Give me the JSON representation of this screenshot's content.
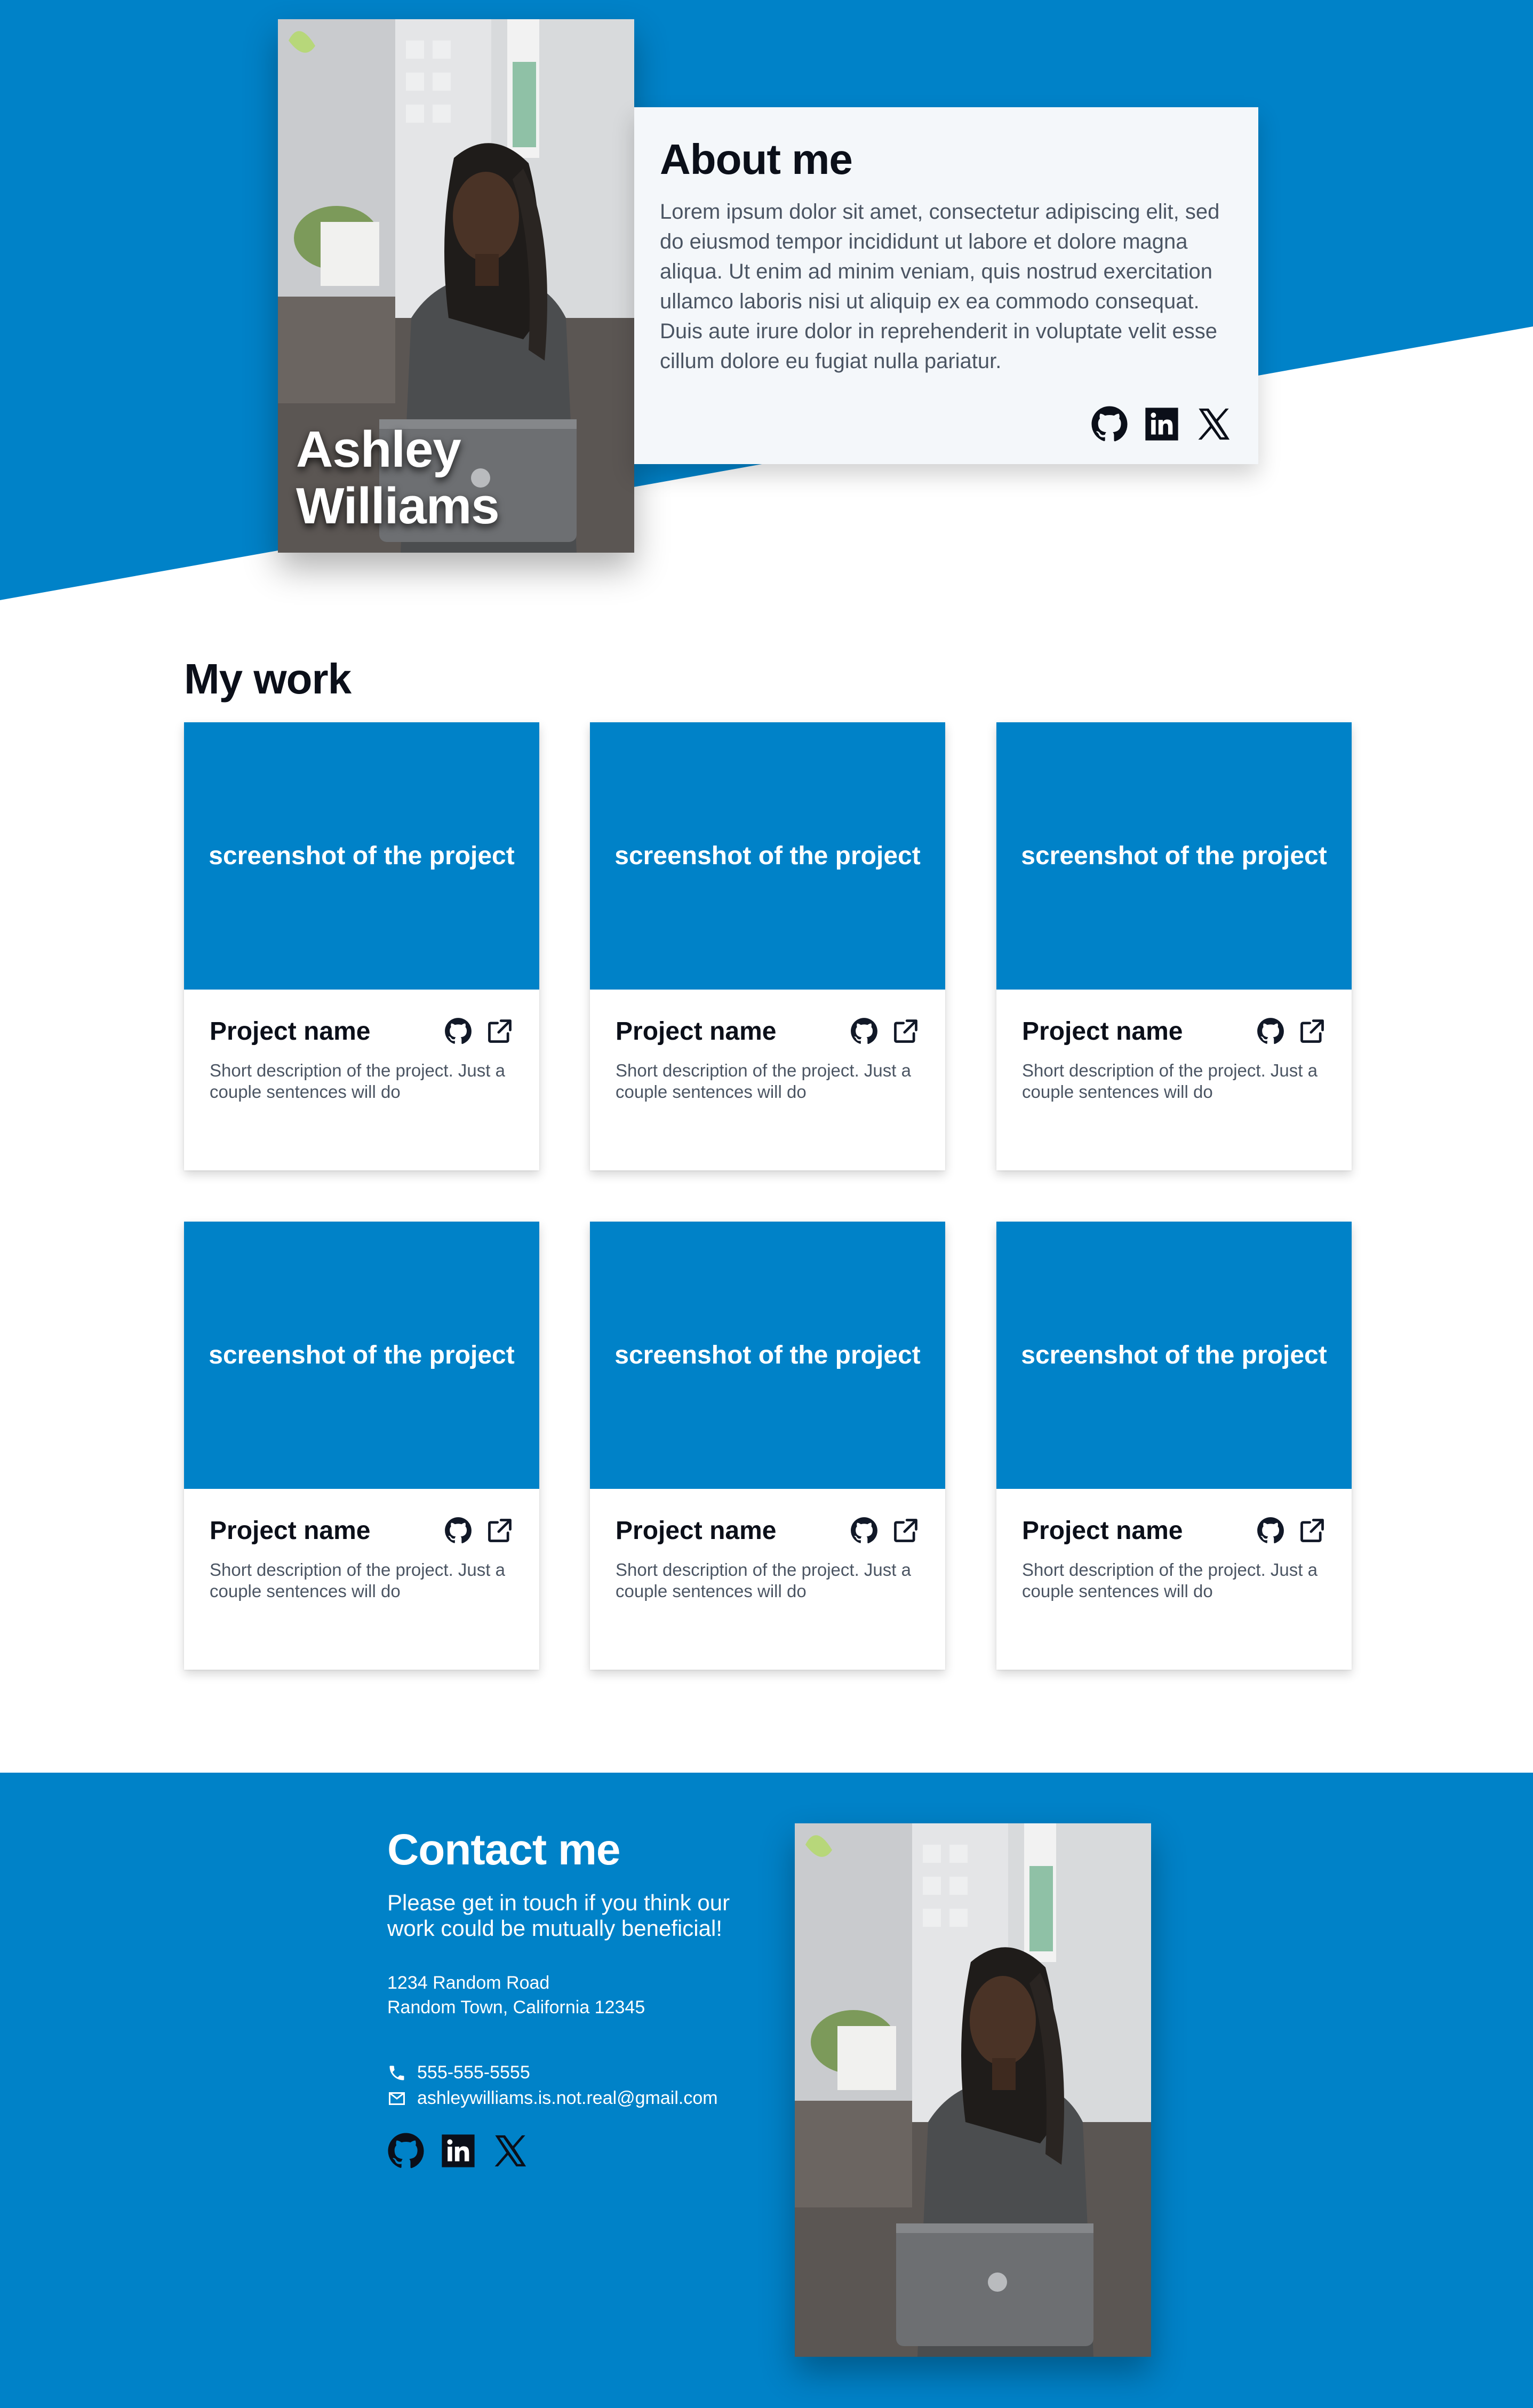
{
  "colors": {
    "brand_blue": "#0082c8",
    "about_bg": "#f4f7fa",
    "heading": "#0b0f19",
    "body_text": "#4b5563"
  },
  "hero": {
    "name_line1": "Ashley",
    "name_line2": "Williams",
    "photo_icon": "portrait-photo",
    "about": {
      "title": "About me",
      "text": "Lorem ipsum dolor sit amet, consectetur adipiscing elit, sed do eiusmod tempor incididunt ut labore et dolore magna aliqua. Ut enim ad minim veniam, quis nostrud exercitation ullamco laboris nisi ut aliquip ex ea commodo consequat. Duis aute irure dolor in reprehenderit in voluptate velit esse cillum dolore eu fugiat nulla pariatur.",
      "social_icons": [
        "github-icon",
        "linkedin-icon",
        "x-icon"
      ]
    }
  },
  "work": {
    "title": "My work",
    "projects": [
      {
        "screenshot": "screenshot of the project",
        "name": "Project name",
        "description": "Short description of the project. Just a couple sentences will do"
      },
      {
        "screenshot": "screenshot of the project",
        "name": "Project name",
        "description": "Short description of the project. Just a couple sentences will do"
      },
      {
        "screenshot": "screenshot of the project",
        "name": "Project name",
        "description": "Short description of the project. Just a couple sentences will do"
      },
      {
        "screenshot": "screenshot of the project",
        "name": "Project name",
        "description": "Short description of the project. Just a couple sentences will do"
      },
      {
        "screenshot": "screenshot of the project",
        "name": "Project name",
        "description": "Short description of the project. Just a couple sentences will do"
      },
      {
        "screenshot": "screenshot of the project",
        "name": "Project name",
        "description": "Short description of the project. Just a couple sentences will do"
      }
    ]
  },
  "contact": {
    "title": "Contact me",
    "text": "Please get in touch if you think our work could be mutually beneficial!",
    "address_line1": "1234 Random Road",
    "address_line2": "Random Town, California 12345",
    "phone": "555-555-5555",
    "email": "ashleywilliams.is.not.real@gmail.com",
    "social_icons": [
      "github-icon",
      "linkedin-icon",
      "x-icon"
    ]
  }
}
